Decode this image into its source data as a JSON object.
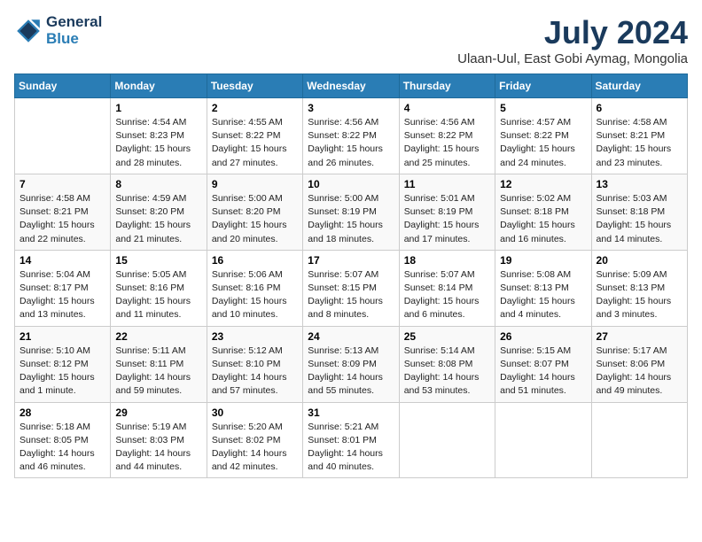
{
  "header": {
    "logo_line1": "General",
    "logo_line2": "Blue",
    "month_year": "July 2024",
    "location": "Ulaan-Uul, East Gobi Aymag, Mongolia"
  },
  "weekdays": [
    "Sunday",
    "Monday",
    "Tuesday",
    "Wednesday",
    "Thursday",
    "Friday",
    "Saturday"
  ],
  "weeks": [
    [
      {
        "day": "",
        "sunrise": "",
        "sunset": "",
        "daylight": ""
      },
      {
        "day": "1",
        "sunrise": "Sunrise: 4:54 AM",
        "sunset": "Sunset: 8:23 PM",
        "daylight": "Daylight: 15 hours and 28 minutes."
      },
      {
        "day": "2",
        "sunrise": "Sunrise: 4:55 AM",
        "sunset": "Sunset: 8:22 PM",
        "daylight": "Daylight: 15 hours and 27 minutes."
      },
      {
        "day": "3",
        "sunrise": "Sunrise: 4:56 AM",
        "sunset": "Sunset: 8:22 PM",
        "daylight": "Daylight: 15 hours and 26 minutes."
      },
      {
        "day": "4",
        "sunrise": "Sunrise: 4:56 AM",
        "sunset": "Sunset: 8:22 PM",
        "daylight": "Daylight: 15 hours and 25 minutes."
      },
      {
        "day": "5",
        "sunrise": "Sunrise: 4:57 AM",
        "sunset": "Sunset: 8:22 PM",
        "daylight": "Daylight: 15 hours and 24 minutes."
      },
      {
        "day": "6",
        "sunrise": "Sunrise: 4:58 AM",
        "sunset": "Sunset: 8:21 PM",
        "daylight": "Daylight: 15 hours and 23 minutes."
      }
    ],
    [
      {
        "day": "7",
        "sunrise": "Sunrise: 4:58 AM",
        "sunset": "Sunset: 8:21 PM",
        "daylight": "Daylight: 15 hours and 22 minutes."
      },
      {
        "day": "8",
        "sunrise": "Sunrise: 4:59 AM",
        "sunset": "Sunset: 8:20 PM",
        "daylight": "Daylight: 15 hours and 21 minutes."
      },
      {
        "day": "9",
        "sunrise": "Sunrise: 5:00 AM",
        "sunset": "Sunset: 8:20 PM",
        "daylight": "Daylight: 15 hours and 20 minutes."
      },
      {
        "day": "10",
        "sunrise": "Sunrise: 5:00 AM",
        "sunset": "Sunset: 8:19 PM",
        "daylight": "Daylight: 15 hours and 18 minutes."
      },
      {
        "day": "11",
        "sunrise": "Sunrise: 5:01 AM",
        "sunset": "Sunset: 8:19 PM",
        "daylight": "Daylight: 15 hours and 17 minutes."
      },
      {
        "day": "12",
        "sunrise": "Sunrise: 5:02 AM",
        "sunset": "Sunset: 8:18 PM",
        "daylight": "Daylight: 15 hours and 16 minutes."
      },
      {
        "day": "13",
        "sunrise": "Sunrise: 5:03 AM",
        "sunset": "Sunset: 8:18 PM",
        "daylight": "Daylight: 15 hours and 14 minutes."
      }
    ],
    [
      {
        "day": "14",
        "sunrise": "Sunrise: 5:04 AM",
        "sunset": "Sunset: 8:17 PM",
        "daylight": "Daylight: 15 hours and 13 minutes."
      },
      {
        "day": "15",
        "sunrise": "Sunrise: 5:05 AM",
        "sunset": "Sunset: 8:16 PM",
        "daylight": "Daylight: 15 hours and 11 minutes."
      },
      {
        "day": "16",
        "sunrise": "Sunrise: 5:06 AM",
        "sunset": "Sunset: 8:16 PM",
        "daylight": "Daylight: 15 hours and 10 minutes."
      },
      {
        "day": "17",
        "sunrise": "Sunrise: 5:07 AM",
        "sunset": "Sunset: 8:15 PM",
        "daylight": "Daylight: 15 hours and 8 minutes."
      },
      {
        "day": "18",
        "sunrise": "Sunrise: 5:07 AM",
        "sunset": "Sunset: 8:14 PM",
        "daylight": "Daylight: 15 hours and 6 minutes."
      },
      {
        "day": "19",
        "sunrise": "Sunrise: 5:08 AM",
        "sunset": "Sunset: 8:13 PM",
        "daylight": "Daylight: 15 hours and 4 minutes."
      },
      {
        "day": "20",
        "sunrise": "Sunrise: 5:09 AM",
        "sunset": "Sunset: 8:13 PM",
        "daylight": "Daylight: 15 hours and 3 minutes."
      }
    ],
    [
      {
        "day": "21",
        "sunrise": "Sunrise: 5:10 AM",
        "sunset": "Sunset: 8:12 PM",
        "daylight": "Daylight: 15 hours and 1 minute."
      },
      {
        "day": "22",
        "sunrise": "Sunrise: 5:11 AM",
        "sunset": "Sunset: 8:11 PM",
        "daylight": "Daylight: 14 hours and 59 minutes."
      },
      {
        "day": "23",
        "sunrise": "Sunrise: 5:12 AM",
        "sunset": "Sunset: 8:10 PM",
        "daylight": "Daylight: 14 hours and 57 minutes."
      },
      {
        "day": "24",
        "sunrise": "Sunrise: 5:13 AM",
        "sunset": "Sunset: 8:09 PM",
        "daylight": "Daylight: 14 hours and 55 minutes."
      },
      {
        "day": "25",
        "sunrise": "Sunrise: 5:14 AM",
        "sunset": "Sunset: 8:08 PM",
        "daylight": "Daylight: 14 hours and 53 minutes."
      },
      {
        "day": "26",
        "sunrise": "Sunrise: 5:15 AM",
        "sunset": "Sunset: 8:07 PM",
        "daylight": "Daylight: 14 hours and 51 minutes."
      },
      {
        "day": "27",
        "sunrise": "Sunrise: 5:17 AM",
        "sunset": "Sunset: 8:06 PM",
        "daylight": "Daylight: 14 hours and 49 minutes."
      }
    ],
    [
      {
        "day": "28",
        "sunrise": "Sunrise: 5:18 AM",
        "sunset": "Sunset: 8:05 PM",
        "daylight": "Daylight: 14 hours and 46 minutes."
      },
      {
        "day": "29",
        "sunrise": "Sunrise: 5:19 AM",
        "sunset": "Sunset: 8:03 PM",
        "daylight": "Daylight: 14 hours and 44 minutes."
      },
      {
        "day": "30",
        "sunrise": "Sunrise: 5:20 AM",
        "sunset": "Sunset: 8:02 PM",
        "daylight": "Daylight: 14 hours and 42 minutes."
      },
      {
        "day": "31",
        "sunrise": "Sunrise: 5:21 AM",
        "sunset": "Sunset: 8:01 PM",
        "daylight": "Daylight: 14 hours and 40 minutes."
      },
      {
        "day": "",
        "sunrise": "",
        "sunset": "",
        "daylight": ""
      },
      {
        "day": "",
        "sunrise": "",
        "sunset": "",
        "daylight": ""
      },
      {
        "day": "",
        "sunrise": "",
        "sunset": "",
        "daylight": ""
      }
    ]
  ]
}
